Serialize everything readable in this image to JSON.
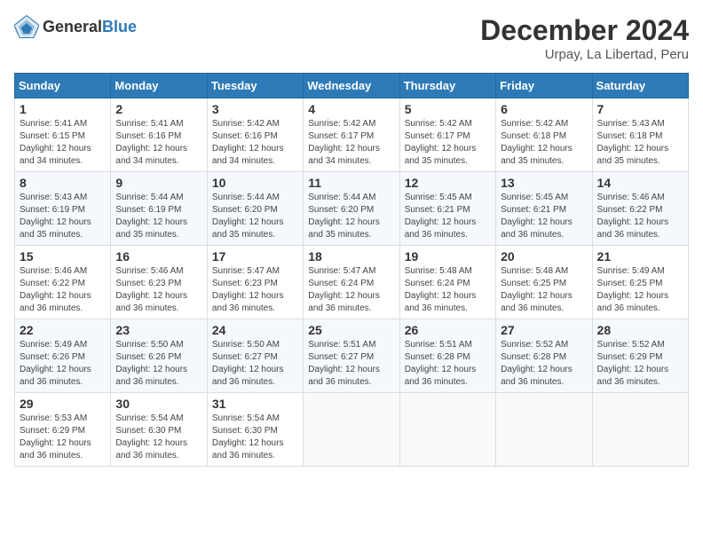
{
  "header": {
    "logo_general": "General",
    "logo_blue": "Blue",
    "month_title": "December 2024",
    "location": "Urpay, La Libertad, Peru"
  },
  "days_of_week": [
    "Sunday",
    "Monday",
    "Tuesday",
    "Wednesday",
    "Thursday",
    "Friday",
    "Saturday"
  ],
  "weeks": [
    [
      {
        "day": "1",
        "detail": "Sunrise: 5:41 AM\nSunset: 6:15 PM\nDaylight: 12 hours and 34 minutes."
      },
      {
        "day": "2",
        "detail": "Sunrise: 5:41 AM\nSunset: 6:16 PM\nDaylight: 12 hours and 34 minutes."
      },
      {
        "day": "3",
        "detail": "Sunrise: 5:42 AM\nSunset: 6:16 PM\nDaylight: 12 hours and 34 minutes."
      },
      {
        "day": "4",
        "detail": "Sunrise: 5:42 AM\nSunset: 6:17 PM\nDaylight: 12 hours and 34 minutes."
      },
      {
        "day": "5",
        "detail": "Sunrise: 5:42 AM\nSunset: 6:17 PM\nDaylight: 12 hours and 35 minutes."
      },
      {
        "day": "6",
        "detail": "Sunrise: 5:42 AM\nSunset: 6:18 PM\nDaylight: 12 hours and 35 minutes."
      },
      {
        "day": "7",
        "detail": "Sunrise: 5:43 AM\nSunset: 6:18 PM\nDaylight: 12 hours and 35 minutes."
      }
    ],
    [
      {
        "day": "8",
        "detail": "Sunrise: 5:43 AM\nSunset: 6:19 PM\nDaylight: 12 hours and 35 minutes."
      },
      {
        "day": "9",
        "detail": "Sunrise: 5:44 AM\nSunset: 6:19 PM\nDaylight: 12 hours and 35 minutes."
      },
      {
        "day": "10",
        "detail": "Sunrise: 5:44 AM\nSunset: 6:20 PM\nDaylight: 12 hours and 35 minutes."
      },
      {
        "day": "11",
        "detail": "Sunrise: 5:44 AM\nSunset: 6:20 PM\nDaylight: 12 hours and 35 minutes."
      },
      {
        "day": "12",
        "detail": "Sunrise: 5:45 AM\nSunset: 6:21 PM\nDaylight: 12 hours and 36 minutes."
      },
      {
        "day": "13",
        "detail": "Sunrise: 5:45 AM\nSunset: 6:21 PM\nDaylight: 12 hours and 36 minutes."
      },
      {
        "day": "14",
        "detail": "Sunrise: 5:46 AM\nSunset: 6:22 PM\nDaylight: 12 hours and 36 minutes."
      }
    ],
    [
      {
        "day": "15",
        "detail": "Sunrise: 5:46 AM\nSunset: 6:22 PM\nDaylight: 12 hours and 36 minutes."
      },
      {
        "day": "16",
        "detail": "Sunrise: 5:46 AM\nSunset: 6:23 PM\nDaylight: 12 hours and 36 minutes."
      },
      {
        "day": "17",
        "detail": "Sunrise: 5:47 AM\nSunset: 6:23 PM\nDaylight: 12 hours and 36 minutes."
      },
      {
        "day": "18",
        "detail": "Sunrise: 5:47 AM\nSunset: 6:24 PM\nDaylight: 12 hours and 36 minutes."
      },
      {
        "day": "19",
        "detail": "Sunrise: 5:48 AM\nSunset: 6:24 PM\nDaylight: 12 hours and 36 minutes."
      },
      {
        "day": "20",
        "detail": "Sunrise: 5:48 AM\nSunset: 6:25 PM\nDaylight: 12 hours and 36 minutes."
      },
      {
        "day": "21",
        "detail": "Sunrise: 5:49 AM\nSunset: 6:25 PM\nDaylight: 12 hours and 36 minutes."
      }
    ],
    [
      {
        "day": "22",
        "detail": "Sunrise: 5:49 AM\nSunset: 6:26 PM\nDaylight: 12 hours and 36 minutes."
      },
      {
        "day": "23",
        "detail": "Sunrise: 5:50 AM\nSunset: 6:26 PM\nDaylight: 12 hours and 36 minutes."
      },
      {
        "day": "24",
        "detail": "Sunrise: 5:50 AM\nSunset: 6:27 PM\nDaylight: 12 hours and 36 minutes."
      },
      {
        "day": "25",
        "detail": "Sunrise: 5:51 AM\nSunset: 6:27 PM\nDaylight: 12 hours and 36 minutes."
      },
      {
        "day": "26",
        "detail": "Sunrise: 5:51 AM\nSunset: 6:28 PM\nDaylight: 12 hours and 36 minutes."
      },
      {
        "day": "27",
        "detail": "Sunrise: 5:52 AM\nSunset: 6:28 PM\nDaylight: 12 hours and 36 minutes."
      },
      {
        "day": "28",
        "detail": "Sunrise: 5:52 AM\nSunset: 6:29 PM\nDaylight: 12 hours and 36 minutes."
      }
    ],
    [
      {
        "day": "29",
        "detail": "Sunrise: 5:53 AM\nSunset: 6:29 PM\nDaylight: 12 hours and 36 minutes."
      },
      {
        "day": "30",
        "detail": "Sunrise: 5:54 AM\nSunset: 6:30 PM\nDaylight: 12 hours and 36 minutes."
      },
      {
        "day": "31",
        "detail": "Sunrise: 5:54 AM\nSunset: 6:30 PM\nDaylight: 12 hours and 36 minutes."
      },
      null,
      null,
      null,
      null
    ]
  ]
}
